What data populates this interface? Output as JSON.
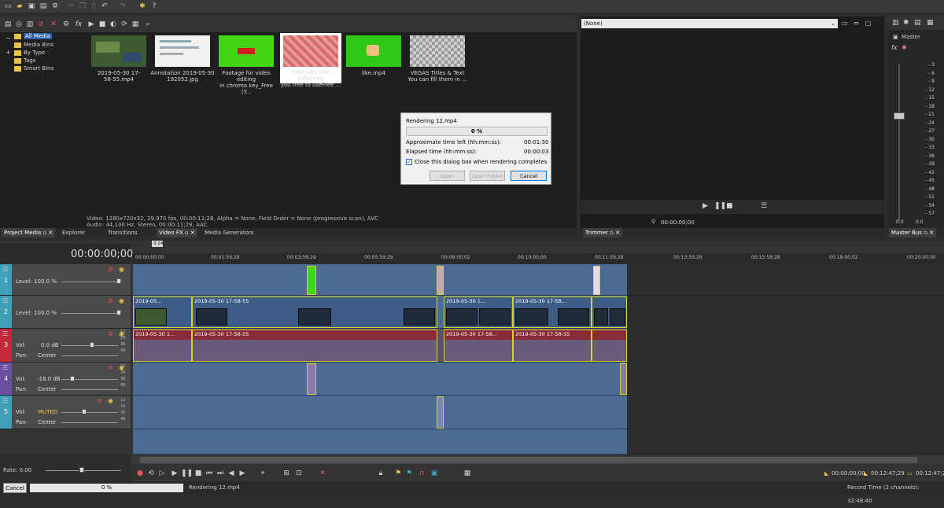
{
  "toolbar": {
    "icons": [
      "new-icon",
      "open-icon",
      "save-icon",
      "save-as-icon",
      "render-icon",
      "properties-icon",
      "undo-icon",
      "redo-icon",
      "cut-icon",
      "copy-icon",
      "paste-icon"
    ]
  },
  "media": {
    "tree": [
      "All Media",
      "Media Bins",
      "By Type",
      "Tags",
      "Smart Bins"
    ],
    "items": [
      {
        "label": "2019-05-30 17-58-55.mp4",
        "label2": "",
        "color": "#3e5a30"
      },
      {
        "label": "Annotation 2019-05-30",
        "label2": "192052.jpg",
        "color": "#f1f1f1"
      },
      {
        "label": "Footage for video editing",
        "label2": "in chroma key_Free (Y...",
        "color": "#43d615"
      },
      {
        "label": "Free Like and subscribe",
        "label2": "you free to useFree ...",
        "color": "#d86a6a"
      },
      {
        "label": "like.mp4",
        "label2": "",
        "color": "#2fc816"
      },
      {
        "label": "VEGAS Titles & Text",
        "label2": "You can fill them in ...",
        "color": "#8a8a8a"
      }
    ],
    "info_line1": "Video: 1280x720x32, 29.970 fps, 00:00:11;28, Alpha = None, Field Order = None (progressive scan), AVC",
    "info_line2": "Audio: 44,100 Hz, Stereo, 00:00:11;28, AAC"
  },
  "tabs_left": [
    "Project Media",
    "Explorer",
    "Transitions",
    "Video FX",
    "Media Generators"
  ],
  "tabs_right": [
    "Trimmer",
    "Master Bus"
  ],
  "dialog": {
    "title": "Rendering 12.mp4",
    "progress": "0 %",
    "time_left_label": "Approximate time left (hh:mm:ss):",
    "time_left": "00:01:30",
    "elapsed_label": "Elapsed time (hh:mm:ss):",
    "elapsed": "00:00:03",
    "checkbox_label": "Close this dialog box when rendering completes",
    "btn_open": "Open",
    "btn_open_folder": "Open Folder",
    "btn_cancel": "Cancel"
  },
  "preview": {
    "select_value": "(None)",
    "timecode": "00:00:00;00"
  },
  "masterbus": {
    "label": "Master",
    "scale": [
      "3",
      "6",
      "9",
      "12",
      "15",
      "18",
      "21",
      "24",
      "27",
      "30",
      "33",
      "36",
      "39",
      "42",
      "45",
      "48",
      "51",
      "54",
      "57"
    ],
    "bottom": [
      "0.0",
      "0.0"
    ]
  },
  "timeline": {
    "timecode": "00:00:00;00",
    "marker": "-3:24",
    "ruler": [
      "00:00:00;00",
      "00:01:59;28",
      "00:03:59;29",
      "00:05:59;29",
      "00:08:00;02",
      "00:10:00;00",
      "00:11:59;28",
      "00:13:59;29",
      "00:15:59;28",
      "00:18:00;02",
      "00:20:00;00"
    ],
    "tracks": [
      {
        "num": "1",
        "label": "Level: 100.0 %",
        "color": "#3fa0b8"
      },
      {
        "num": "2",
        "label": "Level: 100.0 %",
        "color": "#3fa0b8"
      },
      {
        "num": "3",
        "vol": "0.0 dB",
        "pan": "Center",
        "color": "#c3293c"
      },
      {
        "num": "4",
        "vol": "-18.0 dB",
        "pan": "Center",
        "color": "#6b4fa0"
      },
      {
        "num": "5",
        "vol": "MUTED",
        "pan": "Center",
        "color": "#3fa0b8"
      }
    ],
    "vol_label": "Vol:",
    "pan_label": "Pan:",
    "meter_scale": [
      "12",
      "24",
      "36",
      "48"
    ],
    "clip_names": [
      "2019-05...",
      "2019-05-30 17-58-55",
      "2019-05-30 1...",
      "2019-05-30 17-58...",
      "2019-05-30 1...",
      "2019-05-30 17-58-55",
      "2019-05-30 17-58...",
      "2019-05-30 17-58-55"
    ]
  },
  "rate": {
    "label": "Rate: 0.00"
  },
  "status": {
    "cancel": "Cancel",
    "progress": "0 %",
    "rendering": "Rendering 12.mp4",
    "record_time": "Record Time (2 channels): 32:48:40",
    "tc1": "00:00:00;00",
    "tc2": "00:12:47;29",
    "tc3": "00:12:47;29"
  }
}
